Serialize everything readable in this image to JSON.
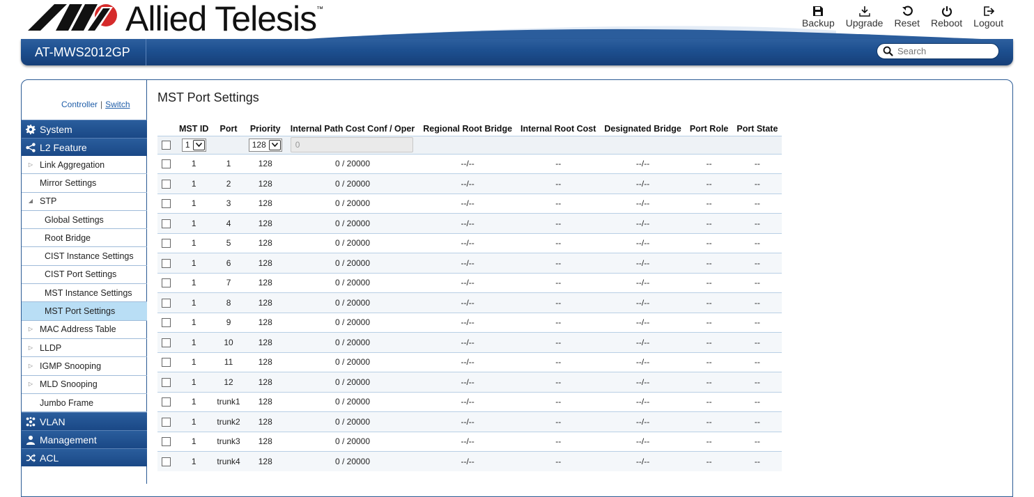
{
  "header": {
    "brand": "Allied Telesis",
    "trademark": "™",
    "product": "AT-MWS2012GP",
    "toolbar": [
      {
        "label": "Backup",
        "icon": "save-icon"
      },
      {
        "label": "Upgrade",
        "icon": "download-icon"
      },
      {
        "label": "Reset",
        "icon": "reset-icon"
      },
      {
        "label": "Reboot",
        "icon": "power-icon"
      },
      {
        "label": "Logout",
        "icon": "logout-icon"
      }
    ],
    "search_placeholder": "Search"
  },
  "sidebar": {
    "controller": "Controller",
    "separator": "|",
    "switch": "Switch",
    "categories": {
      "system": "System",
      "l2": "L2 Feature",
      "vlan": "VLAN",
      "management": "Management",
      "acl": "ACL"
    },
    "l2_items": [
      "Link Aggregation",
      "Mirror Settings",
      "STP",
      "Global Settings",
      "Root Bridge",
      "CIST Instance Settings",
      "CIST Port Settings",
      "MST Instance Settings",
      "MST Port Settings",
      "MAC Address Table",
      "LLDP",
      "IGMP Snooping",
      "MLD Snooping",
      "Jumbo Frame"
    ]
  },
  "page": {
    "title": "MST Port Settings",
    "columns": [
      "MST ID",
      "Port",
      "Priority",
      "Internal Path Cost Conf / Oper",
      "Regional Root Bridge",
      "Internal Root Cost",
      "Designated Bridge",
      "Port Role",
      "Port State"
    ],
    "edit_row": {
      "mst_id": "1",
      "priority": "128",
      "cost_placeholder": "0"
    },
    "rows": [
      {
        "mst": "1",
        "port": "1",
        "priority": "128",
        "cost": "0 / 20000",
        "rrb": "--/--",
        "irc": "--",
        "db": "--/--",
        "role": "--",
        "state": "--"
      },
      {
        "mst": "1",
        "port": "2",
        "priority": "128",
        "cost": "0 / 20000",
        "rrb": "--/--",
        "irc": "--",
        "db": "--/--",
        "role": "--",
        "state": "--"
      },
      {
        "mst": "1",
        "port": "3",
        "priority": "128",
        "cost": "0 / 20000",
        "rrb": "--/--",
        "irc": "--",
        "db": "--/--",
        "role": "--",
        "state": "--"
      },
      {
        "mst": "1",
        "port": "4",
        "priority": "128",
        "cost": "0 / 20000",
        "rrb": "--/--",
        "irc": "--",
        "db": "--/--",
        "role": "--",
        "state": "--"
      },
      {
        "mst": "1",
        "port": "5",
        "priority": "128",
        "cost": "0 / 20000",
        "rrb": "--/--",
        "irc": "--",
        "db": "--/--",
        "role": "--",
        "state": "--"
      },
      {
        "mst": "1",
        "port": "6",
        "priority": "128",
        "cost": "0 / 20000",
        "rrb": "--/--",
        "irc": "--",
        "db": "--/--",
        "role": "--",
        "state": "--"
      },
      {
        "mst": "1",
        "port": "7",
        "priority": "128",
        "cost": "0 / 20000",
        "rrb": "--/--",
        "irc": "--",
        "db": "--/--",
        "role": "--",
        "state": "--"
      },
      {
        "mst": "1",
        "port": "8",
        "priority": "128",
        "cost": "0 / 20000",
        "rrb": "--/--",
        "irc": "--",
        "db": "--/--",
        "role": "--",
        "state": "--"
      },
      {
        "mst": "1",
        "port": "9",
        "priority": "128",
        "cost": "0 / 20000",
        "rrb": "--/--",
        "irc": "--",
        "db": "--/--",
        "role": "--",
        "state": "--"
      },
      {
        "mst": "1",
        "port": "10",
        "priority": "128",
        "cost": "0 / 20000",
        "rrb": "--/--",
        "irc": "--",
        "db": "--/--",
        "role": "--",
        "state": "--"
      },
      {
        "mst": "1",
        "port": "11",
        "priority": "128",
        "cost": "0 / 20000",
        "rrb": "--/--",
        "irc": "--",
        "db": "--/--",
        "role": "--",
        "state": "--"
      },
      {
        "mst": "1",
        "port": "12",
        "priority": "128",
        "cost": "0 / 20000",
        "rrb": "--/--",
        "irc": "--",
        "db": "--/--",
        "role": "--",
        "state": "--"
      },
      {
        "mst": "1",
        "port": "trunk1",
        "priority": "128",
        "cost": "0 / 20000",
        "rrb": "--/--",
        "irc": "--",
        "db": "--/--",
        "role": "--",
        "state": "--"
      },
      {
        "mst": "1",
        "port": "trunk2",
        "priority": "128",
        "cost": "0 / 20000",
        "rrb": "--/--",
        "irc": "--",
        "db": "--/--",
        "role": "--",
        "state": "--"
      },
      {
        "mst": "1",
        "port": "trunk3",
        "priority": "128",
        "cost": "0 / 20000",
        "rrb": "--/--",
        "irc": "--",
        "db": "--/--",
        "role": "--",
        "state": "--"
      },
      {
        "mst": "1",
        "port": "trunk4",
        "priority": "128",
        "cost": "0 / 20000",
        "rrb": "--/--",
        "irc": "--",
        "db": "--/--",
        "role": "--",
        "state": "--"
      }
    ]
  },
  "colors": {
    "nav_blue": "#1d4f8f",
    "selected_row": "#b9def5",
    "logo_red": "#d52b2b"
  }
}
